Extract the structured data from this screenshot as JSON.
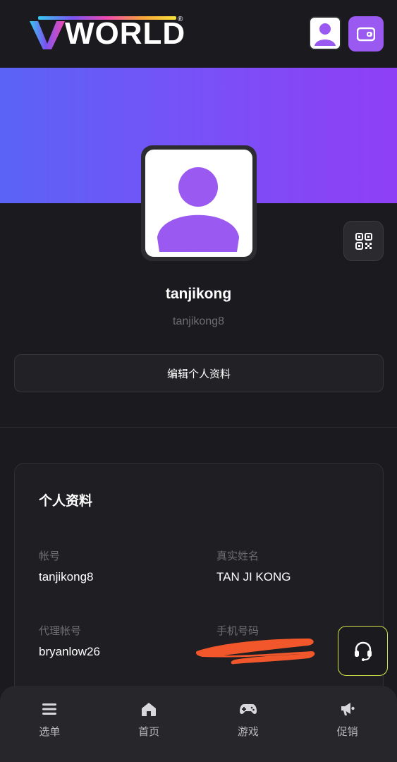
{
  "header": {
    "logo_text": "WORLD",
    "logo_mark": "V",
    "logo_registered": "®",
    "icons": {
      "avatar": "user-avatar-icon",
      "wallet": "wallet-icon"
    }
  },
  "profile": {
    "username": "tanjikong",
    "user_id": "tanjikong8",
    "edit_button": "编辑个人资料",
    "qr_icon": "qr-code-icon"
  },
  "card": {
    "title": "个人资料",
    "fields": [
      {
        "label": "帐号",
        "value": "tanjikong8"
      },
      {
        "label": "真实姓名",
        "value": "TAN JI KONG"
      },
      {
        "label": "代理帐号",
        "value": "bryanlow26"
      },
      {
        "label": "手机号码",
        "value": ""
      }
    ]
  },
  "support_icon": "headset-icon",
  "nav": [
    {
      "label": "选单",
      "icon": "menu-icon"
    },
    {
      "label": "首页",
      "icon": "home-icon"
    },
    {
      "label": "游戏",
      "icon": "gamepad-icon"
    },
    {
      "label": "促销",
      "icon": "megaphone-icon"
    }
  ],
  "colors": {
    "background": "#1b1b1f",
    "accent": "#9a59f0",
    "banner_start": "#5a63f6",
    "banner_end": "#8f3ff6",
    "support_border": "#d6e64a",
    "redaction": "#f2572c"
  }
}
